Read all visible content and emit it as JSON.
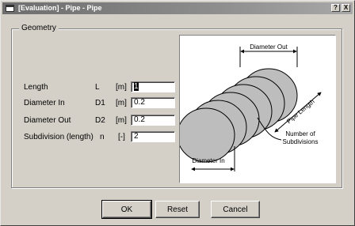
{
  "window": {
    "title": "[Evaluation] - Pipe - Pipe",
    "help_label": "?",
    "close_label": "X"
  },
  "geometry": {
    "group_label": "Geometry",
    "rows": [
      {
        "label": "Length",
        "symbol": "L",
        "unit": "[m]",
        "value": "1"
      },
      {
        "label": "Diameter In",
        "symbol": "D1",
        "unit": "[m]",
        "value": "0.2"
      },
      {
        "label": "Diameter Out",
        "symbol": "D2",
        "unit": "[m]",
        "value": "0.2"
      },
      {
        "label": "Subdivision (length)",
        "symbol": "n",
        "unit": "[-]",
        "value": "2"
      }
    ]
  },
  "diagram": {
    "diameter_out_label": "Diameter Out",
    "diameter_in_label": "Diameter In",
    "pipe_length_label": "Pipe Length",
    "subdivisions_label_line1": "Number of",
    "subdivisions_label_line2": "Subdivisions"
  },
  "buttons": {
    "ok": "OK",
    "reset": "Reset",
    "cancel": "Cancel"
  }
}
